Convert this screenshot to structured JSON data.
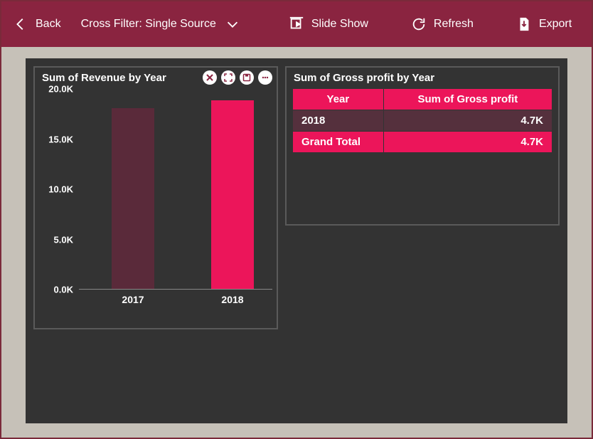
{
  "toolbar": {
    "back": "Back",
    "cross_filter": "Cross Filter: Single Source",
    "slide_show": "Slide Show",
    "refresh": "Refresh",
    "export": "Export"
  },
  "left_panel": {
    "title": "Sum of Revenue by Year"
  },
  "right_panel": {
    "title": "Sum of Gross profit by Year",
    "header_year": "Year",
    "header_value": "Sum of Gross profit",
    "rows": [
      {
        "year": "2018",
        "value": "4.7K"
      }
    ],
    "total_label": "Grand Total",
    "total_value": "4.7K"
  },
  "chart_data": {
    "type": "bar",
    "title": "Sum of Revenue by Year",
    "categories": [
      "2017",
      "2018"
    ],
    "values": [
      18.0,
      18.8
    ],
    "ylabel": "",
    "xlabel": "",
    "y_ticks": [
      "0.0K",
      "5.0K",
      "10.0K",
      "15.0K",
      "20.0K"
    ],
    "ylim": [
      0,
      20
    ]
  }
}
